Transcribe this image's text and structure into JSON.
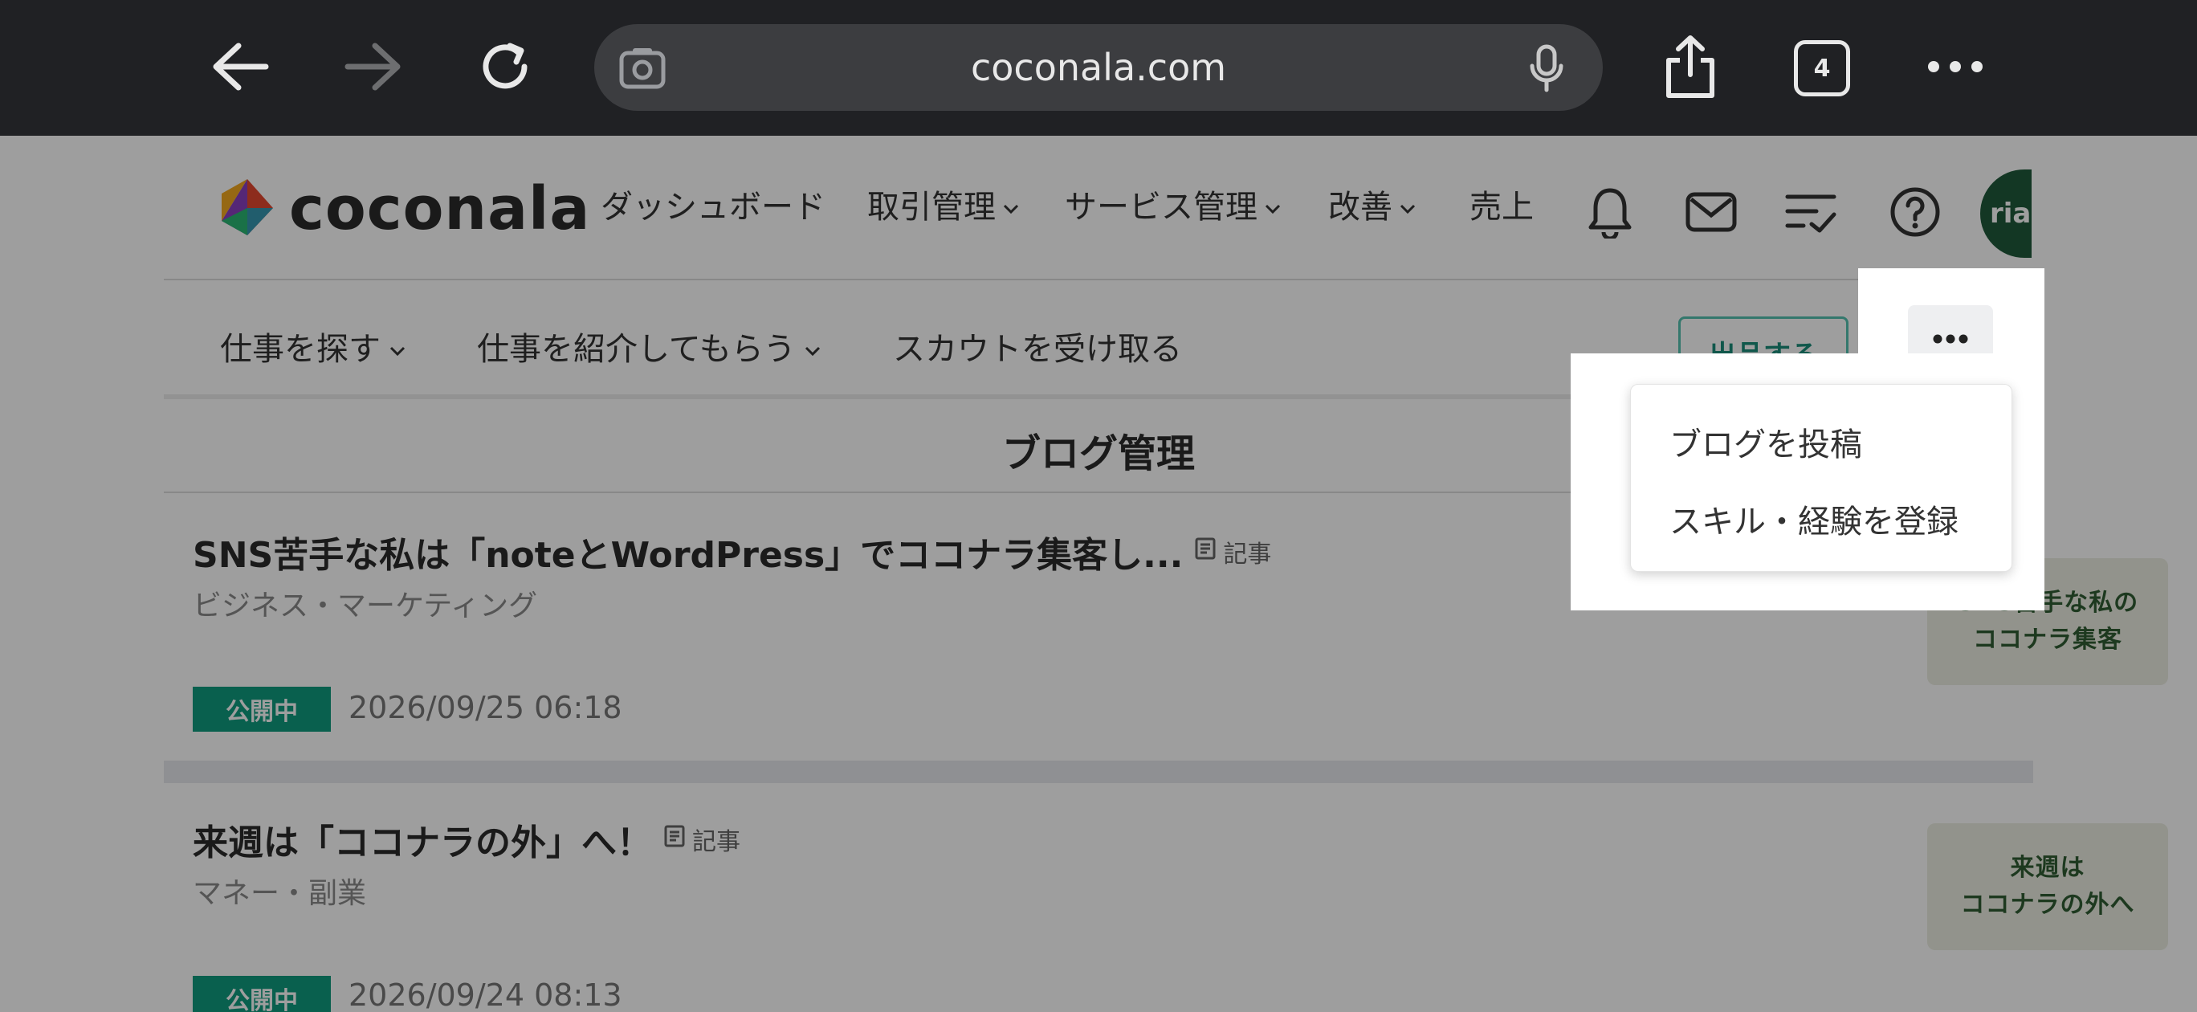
{
  "browser": {
    "url": "coconala.com",
    "tab_count": "4"
  },
  "header": {
    "logo_text": "coconala",
    "nav": {
      "dashboard": "ダッシュボード",
      "transactions": "取引管理",
      "services": "サービス管理",
      "improve": "改善",
      "sales": "売上"
    },
    "avatar_text": "riak"
  },
  "subnav": {
    "find_work": "仕事を探す",
    "get_referrals": "仕事を紹介してもらう",
    "receive_scouts": "スカウトを受け取る",
    "post_button": "出品する"
  },
  "page": {
    "title": "ブログ管理"
  },
  "articles": [
    {
      "title": "SNS苦手な私は「noteとWordPress」でココナラ集客し...",
      "type": "記事",
      "category": "ビジネス・マーケティング",
      "status": "公開中",
      "date": "2026/09/25 06:18",
      "thumb_line1": "SNS苦手な私の",
      "thumb_line2": "ココナラ集客"
    },
    {
      "title": "来週は「ココナラの外」へ！",
      "type": "記事",
      "category": "マネー・副業",
      "status": "公開中",
      "date": "2026/09/24 08:13",
      "thumb_line1": "来週は",
      "thumb_line2": "ココナラの外へ"
    }
  ],
  "dropdown": {
    "items": [
      "ブログを投稿",
      "スキル・経験を登録"
    ]
  },
  "colors": {
    "brand_green": "#0f9b7e",
    "avatar_bg": "#1f5a3a",
    "chrome_bg": "#202124"
  }
}
